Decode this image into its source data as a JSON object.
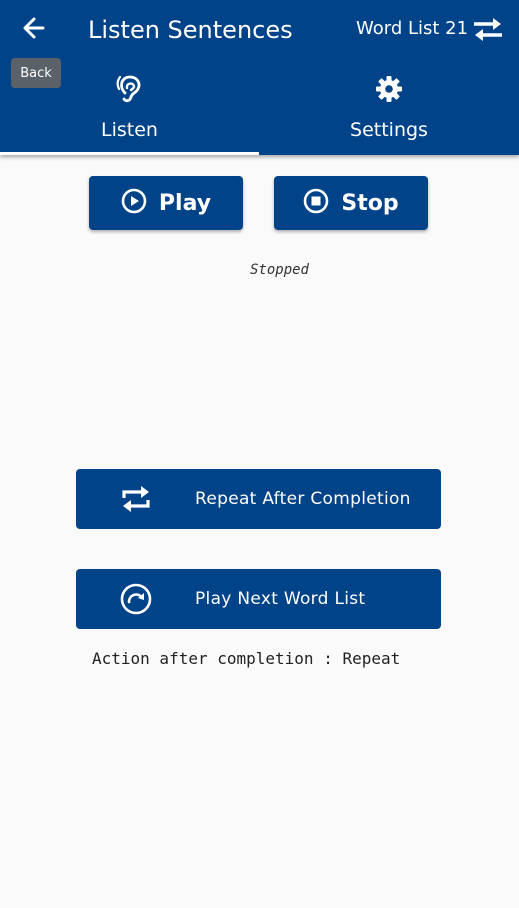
{
  "header": {
    "title": "Listen Sentences",
    "back_tooltip": "Back",
    "word_list": "Word List 21"
  },
  "tabs": [
    {
      "label": "Listen",
      "icon": "ear-icon",
      "active": true
    },
    {
      "label": "Settings",
      "icon": "gear-icon",
      "active": false
    }
  ],
  "controls": {
    "play_label": "Play",
    "stop_label": "Stop",
    "status": "Stopped"
  },
  "actions": {
    "repeat_label": "Repeat After Completion",
    "next_label": "Play Next Word List",
    "completion_text": "Action after completion : Repeat"
  },
  "colors": {
    "primary": "#014389",
    "background": "#fafafa",
    "tooltip": "#5b6168"
  }
}
